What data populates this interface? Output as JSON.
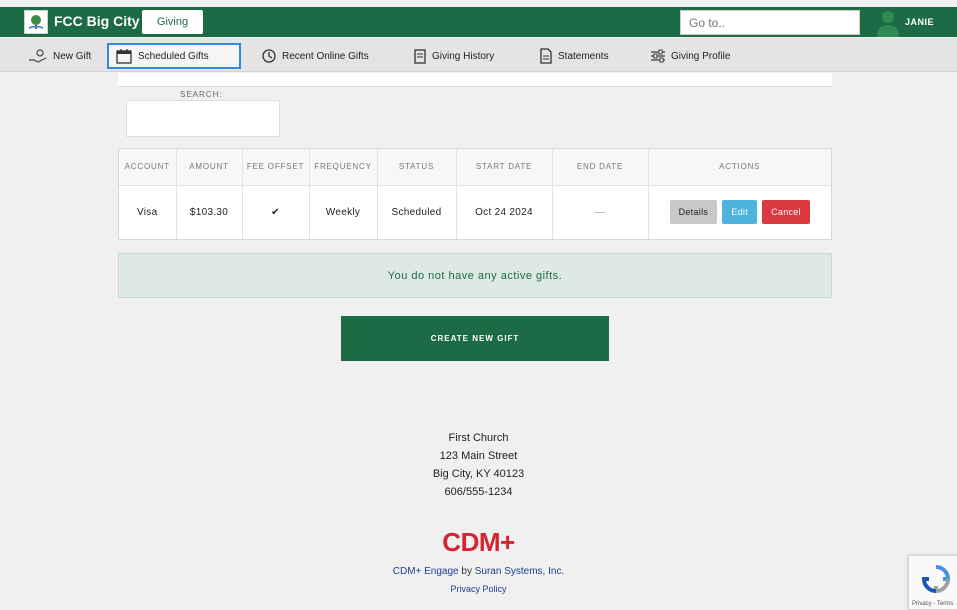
{
  "header": {
    "brand": "FCC Big City",
    "app_label": "Giving",
    "goto_placeholder": "Go to..",
    "user_name": "JANIE"
  },
  "nav": {
    "items": [
      {
        "label": "New Gift",
        "icon": "gift-hand-icon"
      },
      {
        "label": "Scheduled Gifts",
        "icon": "calendar-icon",
        "active": true
      },
      {
        "label": "Recent Online Gifts",
        "icon": "history-icon"
      },
      {
        "label": "Giving History",
        "icon": "history-book-icon"
      },
      {
        "label": "Statements",
        "icon": "document-icon"
      },
      {
        "label": "Giving Profile",
        "icon": "sliders-icon"
      }
    ]
  },
  "search": {
    "label": "SEARCH:"
  },
  "table": {
    "headers": [
      "ACCOUNT",
      "AMOUNT",
      "FEE OFFSET",
      "FREQUENCY",
      "STATUS",
      "START DATE",
      "END DATE",
      "ACTIONS"
    ],
    "rows": [
      {
        "account": "Visa",
        "amount": "$103.30",
        "fee_offset": "✔",
        "frequency": "Weekly",
        "status": "Scheduled",
        "start_date": "Oct 24 2024",
        "end_date": "—",
        "actions": {
          "details": "Details",
          "edit": "Edit",
          "cancel": "Cancel"
        }
      }
    ]
  },
  "notice": "You do not have any active gifts.",
  "create_button": "CREATE NEW GIFT",
  "footer": {
    "org_name": "First Church",
    "street": "123 Main Street",
    "city": "Big City, KY 40123",
    "phone": "606/555-1234",
    "logo_text": "CDM+",
    "product_link": "CDM+ Engage",
    "by": " by ",
    "company_link": "Suran Systems, Inc.",
    "privacy": "Privacy Policy"
  },
  "recaptcha": {
    "text": "Privacy - Terms"
  },
  "colors": {
    "primary_green": "#1d6b45",
    "active_outline": "#2f8ae0",
    "edit_blue": "#4fb4dd",
    "cancel_red": "#d9383e",
    "cdm_red": "#d5232f"
  }
}
